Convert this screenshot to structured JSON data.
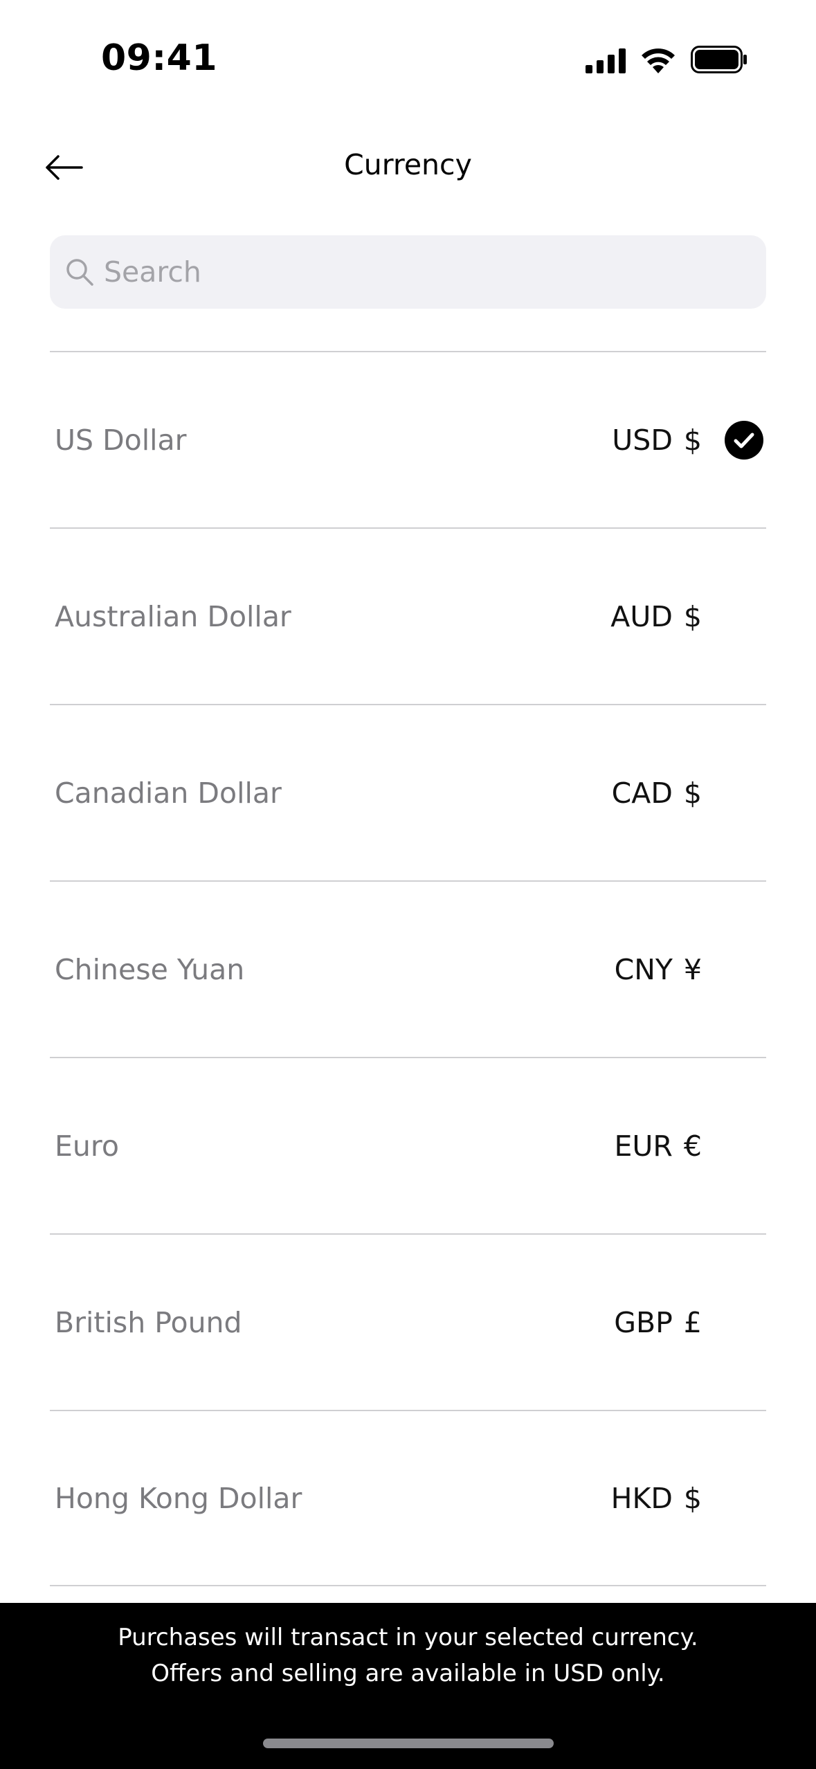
{
  "status_bar": {
    "time": "09:41",
    "icons": [
      "cellular-signal-icon",
      "wifi-icon",
      "battery-icon"
    ]
  },
  "header": {
    "title": "Currency",
    "back_icon": "arrow-left-icon"
  },
  "search": {
    "placeholder": "Search",
    "value": ""
  },
  "currencies": [
    {
      "name": "US Dollar",
      "code": "USD",
      "symbol": "$",
      "selected": true
    },
    {
      "name": "Australian Dollar",
      "code": "AUD",
      "symbol": "$",
      "selected": false
    },
    {
      "name": "Canadian Dollar",
      "code": "CAD",
      "symbol": "$",
      "selected": false
    },
    {
      "name": "Chinese Yuan",
      "code": "CNY",
      "symbol": "¥",
      "selected": false
    },
    {
      "name": "Euro",
      "code": "EUR",
      "symbol": "€",
      "selected": false
    },
    {
      "name": "British Pound",
      "code": "GBP",
      "symbol": "£",
      "selected": false
    },
    {
      "name": "Hong Kong Dollar",
      "code": "HKD",
      "symbol": "$",
      "selected": false
    }
  ],
  "footer": {
    "line1": "Purchases will transact in your selected currency.",
    "line2": "Offers and selling are available in USD only."
  },
  "colors": {
    "background": "#ffffff",
    "search_background": "#f1f1f5",
    "divider": "#cfcfd2",
    "name_text": "#7b7b7f",
    "footer_background": "#000000"
  }
}
